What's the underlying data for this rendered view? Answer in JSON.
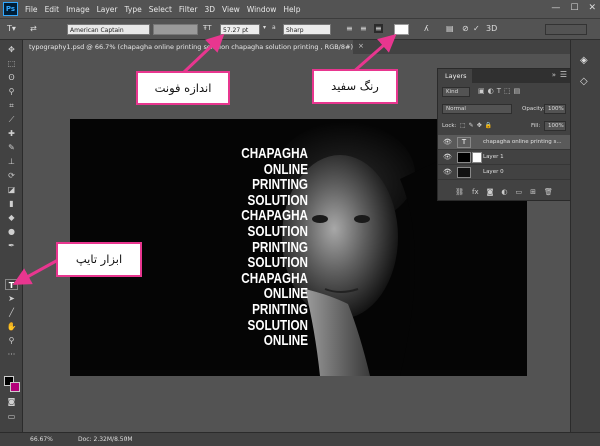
{
  "app": {
    "logo": "Ps"
  },
  "menu": [
    "File",
    "Edit",
    "Image",
    "Layer",
    "Type",
    "Select",
    "Filter",
    "3D",
    "View",
    "Window",
    "Help"
  ],
  "window_controls": [
    "—",
    "☐",
    "✕"
  ],
  "options": {
    "font_family": "American Captain",
    "font_size": "57.27 pt",
    "antialias": "Sharp"
  },
  "document_tab": {
    "title": "typography1.psd @ 66.7% (chapagha online printing solution chapagha  solution printing , RGB/8#) *",
    "close": "×"
  },
  "canvas_text": [
    "CHAPAGHA",
    "ONLINE",
    "PRINTING",
    "SOLUTION",
    "CHAPAGHA",
    "SOLUTION",
    "PRINTING",
    "SOLUTION",
    "CHAPAGHA",
    "ONLINE",
    "PRINTING",
    "SOLUTION",
    "ONLINE"
  ],
  "layers_panel": {
    "tab": "Layers",
    "filter_kind": "Kind",
    "blend_mode": "Normal",
    "opacity_label": "Opacity:",
    "opacity_value": "100%",
    "lock_label": "Lock:",
    "fill_label": "Fill:",
    "fill_value": "100%",
    "layers": [
      {
        "name": "chapagha online printing s...",
        "type": "text",
        "selected": true
      },
      {
        "name": "Layer 1",
        "type": "pixel",
        "selected": false
      },
      {
        "name": "Layer 0",
        "type": "pixel",
        "selected": false
      }
    ]
  },
  "annotations": {
    "font_size_label": "اندازه فونت",
    "white_color_label": "رنگ سفید",
    "type_tool_label": "ابزار تایپ"
  },
  "status": {
    "zoom": "66.67%",
    "doc_size": "Doc: 2.32M/8.50M"
  },
  "colors": {
    "annotation_border": "#e8368f",
    "arrow": "#e8368f",
    "canvas_bg": "#050505",
    "text_color_swatch": "#ffffff",
    "ui_dark": "#424242",
    "ui_mid": "#535353"
  }
}
